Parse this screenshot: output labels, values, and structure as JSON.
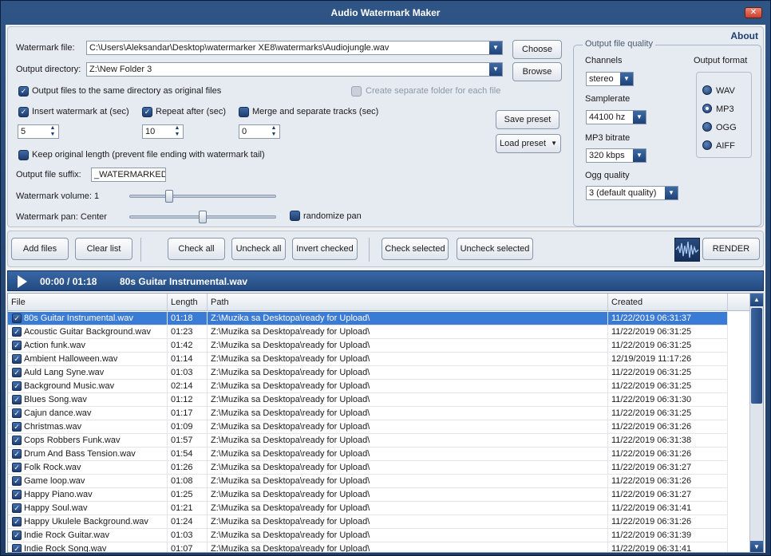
{
  "window": {
    "title": "Audio Watermark Maker",
    "close_glyph": "✕"
  },
  "settings": {
    "about": "About",
    "watermark_file_label": "Watermark file:",
    "watermark_file_value": "C:\\Users\\Aleksandar\\Desktop\\watermarker XE8\\watermarks\\Audiojungle.wav",
    "choose_button": "Choose",
    "output_dir_label": "Output directory:",
    "output_dir_value": "Z:\\New Folder 3",
    "browse_button": "Browse",
    "same_dir_label": "Output files to the same directory as original files",
    "separate_folder_label": "Create separate folder for each file",
    "insert_at_label": "Insert watermark at (sec)",
    "insert_at_value": "5",
    "repeat_after_label": "Repeat after (sec)",
    "repeat_after_value": "10",
    "merge_label": "Merge and separate tracks (sec)",
    "merge_value": "0",
    "save_preset": "Save preset",
    "load_preset": "Load preset",
    "keep_length_label": "Keep original  length (prevent file ending with watermark tail)",
    "suffix_label": "Output file suffix:",
    "suffix_value": "_WATERMARKED",
    "volume_label": "Watermark volume: 1",
    "volume_level": 0.27,
    "pan_label": "Watermark pan: Center",
    "pan_level": 0.5,
    "randomize_pan_label": "randomize pan"
  },
  "quality": {
    "group_title": "Output file quality",
    "channels_label": "Channels",
    "channels_value": "stereo",
    "samplerate_label": "Samplerate",
    "samplerate_value": "44100 hz",
    "mp3_bitrate_label": "MP3 bitrate",
    "mp3_bitrate_value": "320 kbps",
    "ogg_quality_label": "Ogg quality",
    "ogg_quality_value": "3 (default quality)",
    "format_label": "Output format",
    "formats": [
      "WAV",
      "MP3",
      "OGG",
      "AIFF"
    ],
    "selected_format": "MP3"
  },
  "toolbar": {
    "add_files": "Add files",
    "clear_list": "Clear list",
    "check_all": "Check all",
    "uncheck_all": "Uncheck all",
    "invert_checked": "Invert checked",
    "check_selected": "Check selected",
    "uncheck_selected": "Uncheck selected",
    "render": "RENDER"
  },
  "player": {
    "time": "00:00 / 01:18",
    "track": "80s Guitar Instrumental.wav"
  },
  "table": {
    "columns": [
      "File",
      "Length",
      "Path",
      "Created"
    ],
    "check_glyph": "✓",
    "rows": [
      {
        "file": "80s Guitar Instrumental.wav",
        "length": "01:18",
        "path": "Z:\\Muzika sa Desktopa\\ready for Upload\\",
        "created": "11/22/2019 06:31:37"
      },
      {
        "file": "Acoustic Guitar Background.wav",
        "length": "01:23",
        "path": "Z:\\Muzika sa Desktopa\\ready for Upload\\",
        "created": "11/22/2019 06:31:25"
      },
      {
        "file": "Action funk.wav",
        "length": "01:42",
        "path": "Z:\\Muzika sa Desktopa\\ready for Upload\\",
        "created": "11/22/2019 06:31:25"
      },
      {
        "file": "Ambient Halloween.wav",
        "length": "01:14",
        "path": "Z:\\Muzika sa Desktopa\\ready for Upload\\",
        "created": "12/19/2019 11:17:26"
      },
      {
        "file": "Auld Lang Syne.wav",
        "length": "01:03",
        "path": "Z:\\Muzika sa Desktopa\\ready for Upload\\",
        "created": "11/22/2019 06:31:25"
      },
      {
        "file": "Background Music.wav",
        "length": "02:14",
        "path": "Z:\\Muzika sa Desktopa\\ready for Upload\\",
        "created": "11/22/2019 06:31:25"
      },
      {
        "file": "Blues Song.wav",
        "length": "01:12",
        "path": "Z:\\Muzika sa Desktopa\\ready for Upload\\",
        "created": "11/22/2019 06:31:30"
      },
      {
        "file": "Cajun dance.wav",
        "length": "01:17",
        "path": "Z:\\Muzika sa Desktopa\\ready for Upload\\",
        "created": "11/22/2019 06:31:25"
      },
      {
        "file": "Christmas.wav",
        "length": "01:09",
        "path": "Z:\\Muzika sa Desktopa\\ready for Upload\\",
        "created": "11/22/2019 06:31:26"
      },
      {
        "file": "Cops Robbers Funk.wav",
        "length": "01:57",
        "path": "Z:\\Muzika sa Desktopa\\ready for Upload\\",
        "created": "11/22/2019 06:31:38"
      },
      {
        "file": "Drum And Bass Tension.wav",
        "length": "01:54",
        "path": "Z:\\Muzika sa Desktopa\\ready for Upload\\",
        "created": "11/22/2019 06:31:26"
      },
      {
        "file": "Folk Rock.wav",
        "length": "01:26",
        "path": "Z:\\Muzika sa Desktopa\\ready for Upload\\",
        "created": "11/22/2019 06:31:27"
      },
      {
        "file": "Game loop.wav",
        "length": "01:08",
        "path": "Z:\\Muzika sa Desktopa\\ready for Upload\\",
        "created": "11/22/2019 06:31:26"
      },
      {
        "file": "Happy Piano.wav",
        "length": "01:25",
        "path": "Z:\\Muzika sa Desktopa\\ready for Upload\\",
        "created": "11/22/2019 06:31:27"
      },
      {
        "file": "Happy Soul.wav",
        "length": "01:21",
        "path": "Z:\\Muzika sa Desktopa\\ready for Upload\\",
        "created": "11/22/2019 06:31:41"
      },
      {
        "file": "Happy Ukulele Background.wav",
        "length": "01:24",
        "path": "Z:\\Muzika sa Desktopa\\ready for Upload\\",
        "created": "11/22/2019 06:31:26"
      },
      {
        "file": "Indie Rock Guitar.wav",
        "length": "01:03",
        "path": "Z:\\Muzika sa Desktopa\\ready for Upload\\",
        "created": "11/22/2019 06:31:39"
      },
      {
        "file": "Indie Rock Song.wav",
        "length": "01:07",
        "path": "Z:\\Muzika sa Desktopa\\ready for Upload\\",
        "created": "11/22/2019 06:31:41"
      }
    ]
  }
}
